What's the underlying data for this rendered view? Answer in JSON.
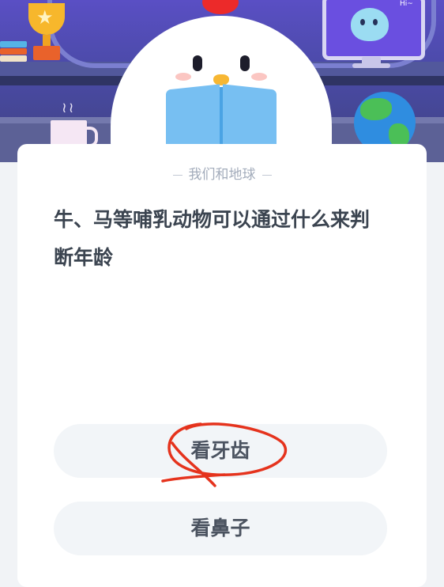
{
  "banner": {
    "monitor_text": "Hi~"
  },
  "card": {
    "category": "我们和地球",
    "question": "牛、马等哺乳动物可以通过什么来判断年龄",
    "options": [
      {
        "label": "看牙齿"
      },
      {
        "label": "看鼻子"
      }
    ]
  },
  "annotation": {
    "color": "#e5331d"
  }
}
